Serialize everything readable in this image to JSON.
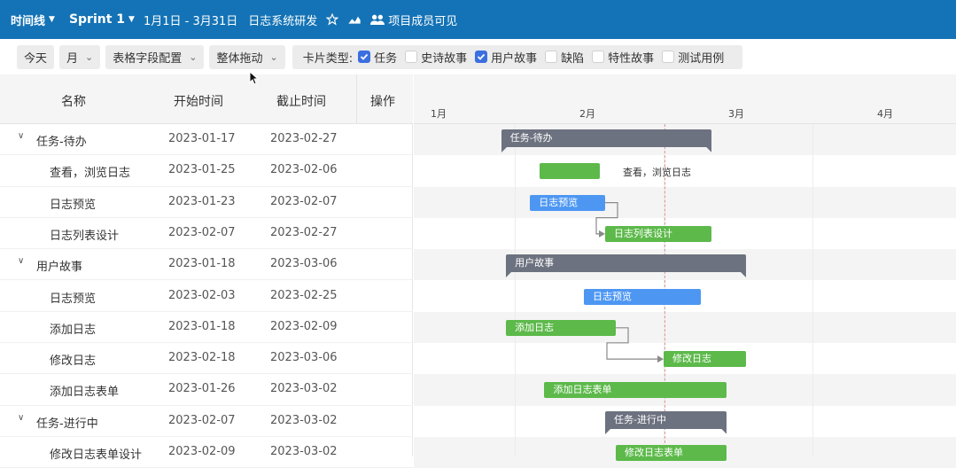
{
  "header": {
    "view_label": "时间线",
    "sprint_label": "Sprint 1",
    "date_range": "1月1日 - 3月31日",
    "project_name": "日志系统研发",
    "visibility": "项目成员可见"
  },
  "toolbar": {
    "today": "今天",
    "scale": "月",
    "field_config": "表格字段配置",
    "drag_mode": "整体拖动",
    "card_type_label": "卡片类型:",
    "card_types": [
      {
        "label": "任务",
        "checked": true
      },
      {
        "label": "史诗故事",
        "checked": false
      },
      {
        "label": "用户故事",
        "checked": true
      },
      {
        "label": "缺陷",
        "checked": false
      },
      {
        "label": "特性故事",
        "checked": false
      },
      {
        "label": "测试用例",
        "checked": false
      }
    ]
  },
  "table": {
    "columns": {
      "name": "名称",
      "start": "开始时间",
      "end": "截止时间",
      "action": "操作"
    },
    "rows": [
      {
        "group": true,
        "name": "任务-待办",
        "start": "2023-01-17",
        "end": "2023-02-27"
      },
      {
        "group": false,
        "name": "查看，浏览日志",
        "start": "2023-01-25",
        "end": "2023-02-06"
      },
      {
        "group": false,
        "name": "日志预览",
        "start": "2023-01-23",
        "end": "2023-02-07"
      },
      {
        "group": false,
        "name": "日志列表设计",
        "start": "2023-02-07",
        "end": "2023-02-27"
      },
      {
        "group": true,
        "name": "用户故事",
        "start": "2023-01-18",
        "end": "2023-03-06"
      },
      {
        "group": false,
        "name": "日志预览",
        "start": "2023-02-03",
        "end": "2023-02-25"
      },
      {
        "group": false,
        "name": "添加日志",
        "start": "2023-01-18",
        "end": "2023-02-09"
      },
      {
        "group": false,
        "name": "修改日志",
        "start": "2023-02-18",
        "end": "2023-03-06"
      },
      {
        "group": false,
        "name": "添加日志表单",
        "start": "2023-01-26",
        "end": "2023-03-02"
      },
      {
        "group": true,
        "name": "任务-进行中",
        "start": "2023-02-07",
        "end": "2023-03-02"
      },
      {
        "group": false,
        "name": "修改日志表单设计",
        "start": "2023-02-09",
        "end": "2023-03-02"
      }
    ]
  },
  "timeline": {
    "months": [
      "1月",
      "2月",
      "3月",
      "4月"
    ],
    "bars": [
      {
        "label": "任务-待办",
        "kind": "group",
        "start": "2023-01-17",
        "end": "2023-02-27"
      },
      {
        "label": "查看，浏览日志",
        "kind": "green",
        "start": "2023-01-25",
        "end": "2023-02-06",
        "outside": true
      },
      {
        "label": "日志预览",
        "kind": "blue",
        "start": "2023-01-23",
        "end": "2023-02-07"
      },
      {
        "label": "日志列表设计",
        "kind": "green",
        "start": "2023-02-07",
        "end": "2023-02-27"
      },
      {
        "label": "用户故事",
        "kind": "group",
        "start": "2023-01-18",
        "end": "2023-03-06"
      },
      {
        "label": "日志预览",
        "kind": "blue",
        "start": "2023-02-03",
        "end": "2023-02-25"
      },
      {
        "label": "添加日志",
        "kind": "green",
        "start": "2023-01-18",
        "end": "2023-02-09"
      },
      {
        "label": "修改日志",
        "kind": "green",
        "start": "2023-02-18",
        "end": "2023-03-06"
      },
      {
        "label": "添加日志表单",
        "kind": "green",
        "start": "2023-01-26",
        "end": "2023-03-02"
      },
      {
        "label": "任务-进行中",
        "kind": "group",
        "start": "2023-02-07",
        "end": "2023-03-02"
      },
      {
        "label": "修改日志表单",
        "kind": "green",
        "start": "2023-02-09",
        "end": "2023-03-02"
      }
    ],
    "dependencies": [
      [
        2,
        3
      ],
      [
        6,
        7
      ]
    ]
  }
}
